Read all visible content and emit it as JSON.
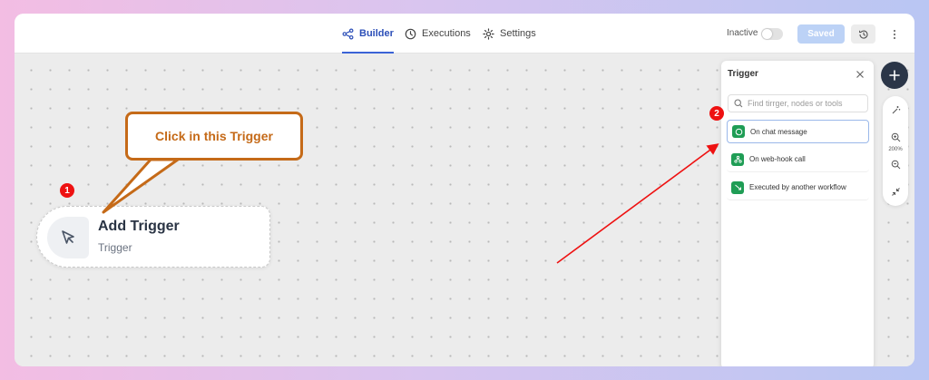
{
  "tabs": [
    {
      "label": "Builder",
      "icon": "share-nodes-icon",
      "active": true
    },
    {
      "label": "Executions",
      "icon": "clock-icon",
      "active": false
    },
    {
      "label": "Settings",
      "icon": "gear-icon",
      "active": false
    }
  ],
  "header": {
    "status_label": "Inactive",
    "toggle_on": false,
    "saved_label": "Saved",
    "history_icon": "history-icon",
    "more_icon": "more-vertical-icon"
  },
  "node": {
    "title": "Add Trigger",
    "subtitle": "Trigger",
    "icon": "pointer-cursor-icon"
  },
  "callout": {
    "text": "Click in this Trigger",
    "color": "#c56a18"
  },
  "badges": [
    "1",
    "2"
  ],
  "panel": {
    "title": "Trigger",
    "search_placeholder": "Find tirrger, nodes or tools",
    "items": [
      {
        "label": "On chat message",
        "icon": "chat-icon",
        "selected": true
      },
      {
        "label": "On web-hook call",
        "icon": "webhook-icon",
        "selected": false
      },
      {
        "label": "Executed by another workflow",
        "icon": "workflow-arrow-icon",
        "selected": false
      }
    ]
  },
  "zoom": {
    "level": "200%"
  },
  "colors": {
    "accent": "#3a62d6",
    "annotation_red": "#e11111",
    "trigger_green": "#1f9d55",
    "fab_dark": "#2b3648"
  }
}
